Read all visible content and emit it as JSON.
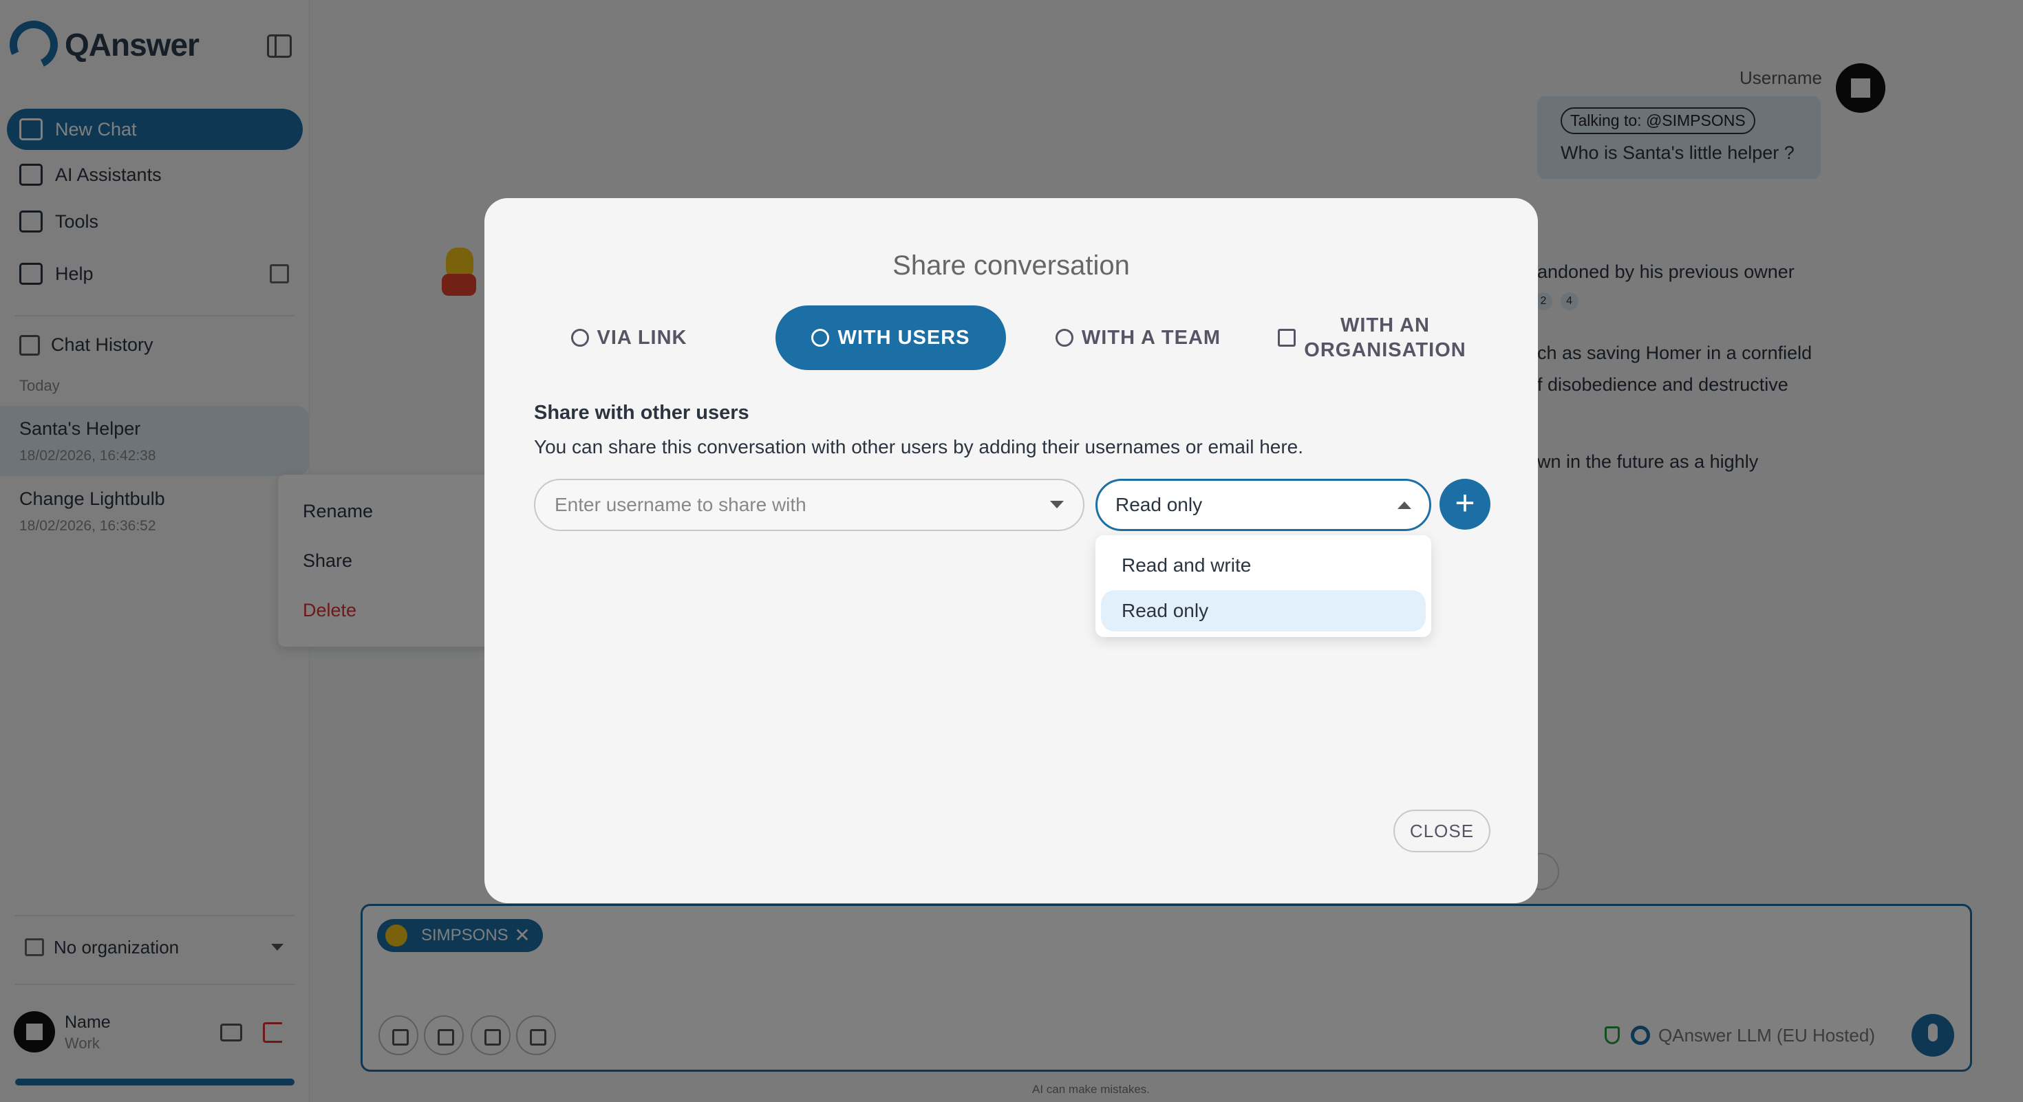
{
  "brand": {
    "name": "QAnswer"
  },
  "sidebar": {
    "nav": [
      {
        "label": "New Chat"
      },
      {
        "label": "AI Assistants"
      },
      {
        "label": "Tools"
      },
      {
        "label": "Help"
      }
    ],
    "history_title": "Chat History",
    "group_label": "Today",
    "chats": [
      {
        "title": "Santa's Helper",
        "date": "18/02/2026, 16:42:38"
      },
      {
        "title": "Change Lightbulb",
        "date": "18/02/2026, 16:36:52"
      }
    ],
    "context_menu": {
      "rename": "Rename",
      "share": "Share",
      "delete": "Delete"
    },
    "organization": "No organization",
    "user": {
      "name": "Name",
      "role": "Work"
    },
    "progress": 1.0
  },
  "chat": {
    "username_label": "Username",
    "talking_to": "Talking to: @SIMPSONS",
    "question": "Who is Santa's little helper ?",
    "answer_fragments": [
      "andoned by his previous owner",
      "ch as saving Homer in a cornfield",
      "f disobedience and destructive",
      "wn in the future as a highly"
    ],
    "citations": [
      "2",
      "4"
    ],
    "assistant_chip": "SIMPSONS",
    "model": "QAnswer LLM (EU Hosted)",
    "disclaimer": "AI can make mistakes."
  },
  "modal": {
    "title": "Share conversation",
    "tabs": [
      {
        "label": "VIA LINK"
      },
      {
        "label": "WITH USERS"
      },
      {
        "label": "WITH A TEAM"
      },
      {
        "label_line1": "WITH AN",
        "label_line2": "ORGANISATION"
      }
    ],
    "section_title": "Share with other users",
    "section_desc": "You can share this conversation with other users by adding their usernames or email here.",
    "user_input_placeholder": "Enter username to share with",
    "permission_value": "Read only",
    "permission_options": [
      "Read and write",
      "Read only"
    ],
    "add_label": "+",
    "close_label": "CLOSE"
  },
  "colors": {
    "accent": "#1b6fa5",
    "danger": "#d33",
    "selected_option": "#e1f0fb"
  }
}
